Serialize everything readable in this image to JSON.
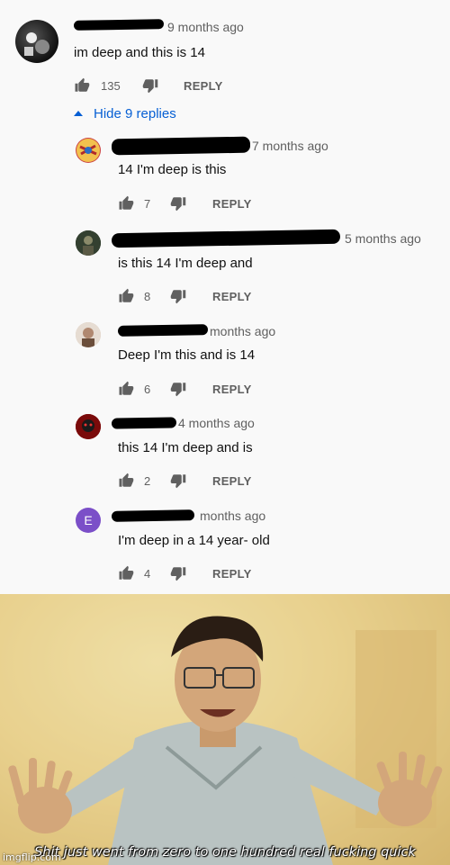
{
  "top_comment": {
    "ago": "9 months ago",
    "text": "im deep and this is 14",
    "likes": "135",
    "reply_label": "REPLY"
  },
  "toggle_label": "Hide 9 replies",
  "replies": [
    {
      "ago": "7 months ago",
      "text": "14 I'm deep is this",
      "likes": "7",
      "reply_label": "REPLY"
    },
    {
      "ago": "5 months ago",
      "text": "is this 14 I'm deep and",
      "likes": "8",
      "reply_label": "REPLY"
    },
    {
      "ago": "months ago",
      "text": "Deep I'm this and is 14",
      "likes": "6",
      "reply_label": "REPLY"
    },
    {
      "ago": "4 months ago",
      "text": "this 14 I'm deep and is",
      "likes": "2",
      "reply_label": "REPLY"
    },
    {
      "ago": "months ago",
      "text": "I'm deep in a 14 year- old",
      "likes": "4",
      "reply_label": "REPLY",
      "avatar_letter": "E"
    }
  ],
  "meme": {
    "caption": "Shit just went from zero to one hundred real fucking quick",
    "watermark": "imgflip.com"
  },
  "colors": {
    "link_blue": "#065fd4",
    "meta_gray": "#606060",
    "avatar_purple": "#7b4fc8"
  }
}
